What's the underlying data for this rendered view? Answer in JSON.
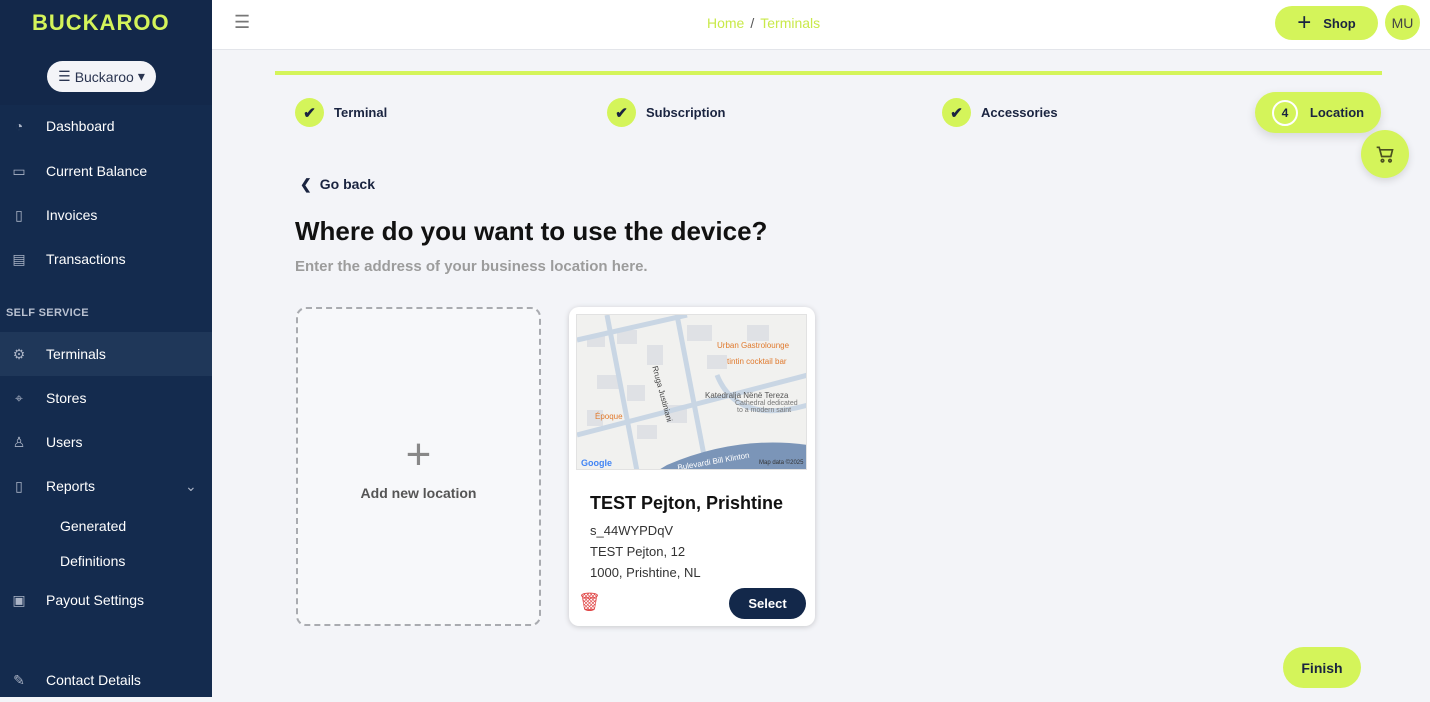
{
  "brand": {
    "logo": "BUCKAROO",
    "org_selector": "Buckaroo",
    "accent": "#d4f45a",
    "navy": "#13284a"
  },
  "sidebar": {
    "items": [
      {
        "label": "Dashboard",
        "icon": "gauge-icon"
      },
      {
        "label": "Current Balance",
        "icon": "credit-card-icon"
      },
      {
        "label": "Invoices",
        "icon": "document-icon"
      },
      {
        "label": "Transactions",
        "icon": "list-icon"
      }
    ],
    "section": "SELF SERVICE",
    "self_service": [
      {
        "label": "Terminals",
        "icon": "gear-icon",
        "active": true
      },
      {
        "label": "Stores",
        "icon": "map-pin-icon"
      },
      {
        "label": "Users",
        "icon": "user-icon"
      },
      {
        "label": "Reports",
        "icon": "document-icon"
      }
    ],
    "reports_sub": [
      "Generated",
      "Definitions"
    ],
    "payout": "Payout Settings",
    "contact": "Contact Details"
  },
  "header": {
    "breadcrumb": [
      "Home",
      "Terminals"
    ],
    "shop_label": "Shop",
    "avatar": "MU"
  },
  "steps": [
    {
      "label": "Terminal",
      "done": true
    },
    {
      "label": "Subscription",
      "done": true
    },
    {
      "label": "Accessories",
      "done": true
    },
    {
      "label": "Location",
      "number": "4",
      "active": true
    }
  ],
  "main": {
    "back": "Go back",
    "title": "Where do you want to use the device?",
    "subtitle": "Enter the address of your business location here.",
    "add_label": "Add new location",
    "finish": "Finish"
  },
  "location": {
    "name": "TEST Pejton, Prishtine",
    "id": "s_44WYPDqV",
    "street": "TEST Pejton, 12",
    "city": "1000, Prishtine, NL",
    "select": "Select",
    "map": {
      "labels": [
        "Urban Gastrolounge",
        "tintin cocktail bar",
        "Katedralja Nënë Tereza",
        "Cathedral dedicated",
        "to a modern saint",
        "Époque",
        "Rruga Justiniani",
        "Bulevardi Bill Klinton",
        "Google",
        "Map data ©2025"
      ]
    }
  }
}
